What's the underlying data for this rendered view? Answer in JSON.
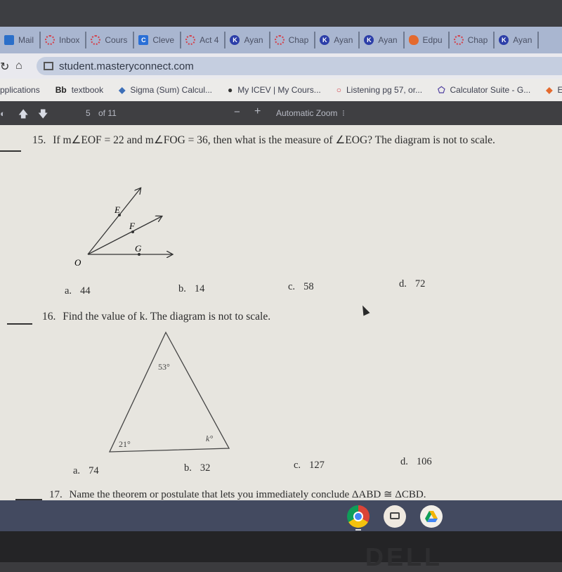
{
  "browser": {
    "tabs": [
      {
        "label": "Mail",
        "icon": "mail-icon",
        "kind": "mail"
      },
      {
        "label": "Inbox",
        "icon": "canvas-icon",
        "kind": "canvas"
      },
      {
        "label": "Cours",
        "icon": "canvas-icon",
        "kind": "canvas"
      },
      {
        "label": "Cleve",
        "icon": "clever-icon",
        "kind": "clever"
      },
      {
        "label": "Act 4",
        "icon": "canvas-icon",
        "kind": "canvas"
      },
      {
        "label": "Ayan",
        "icon": "k-icon",
        "kind": "k"
      },
      {
        "label": "Chap",
        "icon": "canvas-icon",
        "kind": "canvas"
      },
      {
        "label": "Ayan",
        "icon": "k-icon",
        "kind": "k"
      },
      {
        "label": "Ayan",
        "icon": "k-icon",
        "kind": "k"
      },
      {
        "label": "Edpu",
        "icon": "edpuzzle-icon",
        "kind": "edp"
      },
      {
        "label": "Chap",
        "icon": "canvas-icon",
        "kind": "canvas"
      },
      {
        "label": "Ayan",
        "icon": "k-icon",
        "kind": "k"
      }
    ],
    "url": "student.masteryconnect.com",
    "bookmarks": [
      {
        "label": "pplications",
        "icon": "apps-icon",
        "glyph": ""
      },
      {
        "label": "textbook",
        "icon": "blackboard-icon",
        "glyph": "Bb"
      },
      {
        "label": "Sigma (Sum) Calcul...",
        "icon": "sigma-icon",
        "glyph": "◆"
      },
      {
        "label": "My ICEV | My Cours...",
        "icon": "globe-icon",
        "glyph": "●"
      },
      {
        "label": "Listening pg 57, or...",
        "icon": "canvas-icon",
        "glyph": "○"
      },
      {
        "label": "Calculator Suite - G...",
        "icon": "geogebra-icon",
        "glyph": "⬠"
      },
      {
        "label": "Edp",
        "icon": "edpuzzle-icon",
        "glyph": "◆"
      }
    ]
  },
  "pdf_toolbar": {
    "page_current": "5",
    "page_total_text": "of 11",
    "zoom_out": "−",
    "zoom_in": "+",
    "zoom_level": "Automatic Zoom",
    "zoom_arrow": "⁝"
  },
  "questions": [
    {
      "number": "15.",
      "text": "If m∠EOF = 22 and m∠FOG = 36, then what is the measure of ∠EOG? The diagram is not to scale.",
      "diagram_labels": {
        "E": "E",
        "F": "F",
        "G": "G",
        "O": "O"
      },
      "choices": [
        {
          "letter": "a.",
          "value": "44"
        },
        {
          "letter": "b.",
          "value": "14"
        },
        {
          "letter": "c.",
          "value": "58"
        },
        {
          "letter": "d.",
          "value": "72"
        }
      ]
    },
    {
      "number": "16.",
      "text": "Find the value of k. The diagram is not to scale.",
      "diagram_labels": {
        "top": "53°",
        "left": "21°",
        "right": "k°"
      },
      "choices": [
        {
          "letter": "a.",
          "value": "74"
        },
        {
          "letter": "b.",
          "value": "32"
        },
        {
          "letter": "c.",
          "value": "127"
        },
        {
          "letter": "d.",
          "value": "106"
        }
      ]
    },
    {
      "number": "17.",
      "text": "Name the theorem or postulate that lets you immediately conclude ΔABD ≅ ΔCBD."
    }
  ],
  "shelf": [
    {
      "name": "chrome-icon"
    },
    {
      "name": "screencast-icon"
    },
    {
      "name": "google-drive-icon"
    }
  ],
  "hardware": {
    "brand": "DELL"
  }
}
